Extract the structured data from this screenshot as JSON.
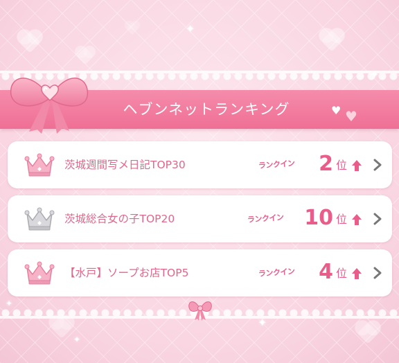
{
  "header": {
    "title": "ヘブンネットランキング"
  },
  "rankings": [
    {
      "crown_color": "pink",
      "title": "茨城週間写メ日記TOP30",
      "badge": "ランクイン",
      "rank": "2",
      "unit": "位",
      "trend_icon": "up-arrow-icon",
      "chevron_icon": "chevron-right-icon"
    },
    {
      "crown_color": "silver",
      "title": "茨城総合女の子TOP20",
      "badge": "ランクイン",
      "rank": "10",
      "unit": "位",
      "trend_icon": "up-arrow-icon",
      "chevron_icon": "chevron-right-icon"
    },
    {
      "crown_color": "pink",
      "title": "【水戸】ソープお店TOP5",
      "badge": "ランクイン",
      "rank": "4",
      "unit": "位",
      "trend_icon": "up-arrow-icon",
      "chevron_icon": "chevron-right-icon"
    }
  ],
  "colors": {
    "accent": "#e85d89",
    "band": "#ef6f95",
    "background": "#f9d5e1",
    "crown_pink": "#f4a3bd",
    "crown_silver": "#c8c8cc",
    "chevron": "#777777"
  }
}
